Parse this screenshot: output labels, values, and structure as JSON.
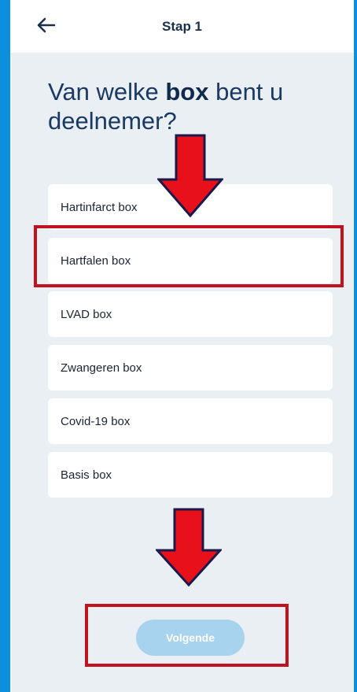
{
  "header": {
    "title": "Stap 1",
    "back_icon": "arrow-left-icon"
  },
  "question": {
    "prefix": "Van welke ",
    "bold": "box",
    "suffix": " bent u deelnemer?"
  },
  "options": [
    {
      "label": "Hartinfarct box"
    },
    {
      "label": "Hartfalen box"
    },
    {
      "label": "LVAD box"
    },
    {
      "label": "Zwangeren box"
    },
    {
      "label": "Covid-19 box"
    },
    {
      "label": "Basis box"
    }
  ],
  "footer": {
    "next_label": "Volgende"
  },
  "colors": {
    "frame": "#0c8fdd",
    "background": "#eaeff4",
    "annotation": "#c1121f",
    "arrow": "#e8111b",
    "button_disabled": "#a8d3ee"
  }
}
